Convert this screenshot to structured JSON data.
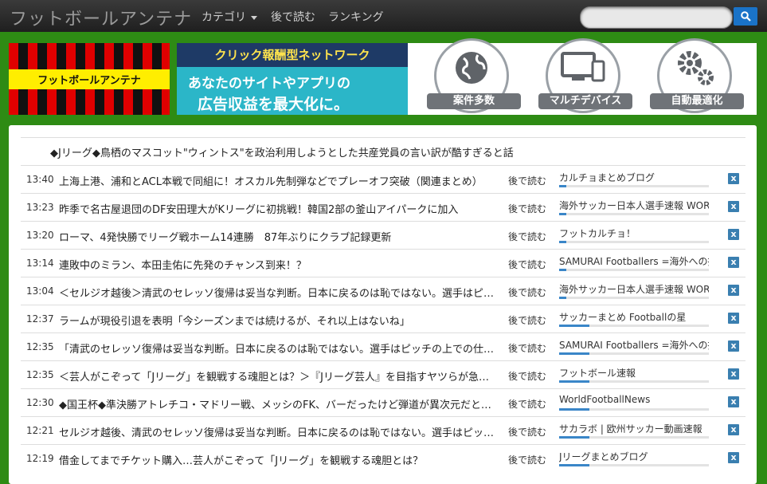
{
  "header": {
    "logo": "フットボールアンテナ",
    "nav": [
      "カテゴリ",
      "後で読む",
      "ランキング"
    ],
    "search_placeholder": ""
  },
  "banner_logo": "フットボールアンテナ",
  "ad": {
    "head": "クリック報酬型ネットワーク",
    "line1": "あなたのサイトやアプリの",
    "line2": "広告収益を最大化に。",
    "features": [
      "案件多数",
      "マルチデバイス",
      "自動最適化"
    ]
  },
  "headline": "◆Jリーグ◆鳥栖のマスコット\"ウィントス\"を政治利用しようとした共産党員の言い訳が酷すぎると話",
  "later_label": "後で読む",
  "close_label": "x",
  "articles": [
    {
      "time": "13:40",
      "title": "上海上港、浦和とACL本戦で同組に！オスカル先制弾などでプレーオフ突破（関連まとめ）",
      "source": "カルチョまとめブログ",
      "popularity": 0.05
    },
    {
      "time": "13:23",
      "title": "昨季で名古屋退団のDF安田理大がKリーグに初挑戦！韓国2部の釜山アイパークに加入",
      "source": "海外サッカー日本人選手速報 WORLD",
      "popularity": 0.05
    },
    {
      "time": "13:20",
      "title": "ローマ、4発快勝でリーグ戦ホーム14連勝　87年ぶりにクラブ記録更新",
      "source": "フットカルチョ！",
      "popularity": 0.05
    },
    {
      "time": "13:14",
      "title": "連敗中のミラン、本田圭佑に先発のチャンス到来！？",
      "source": "SAMURAI Footballers =海外への挑戦=",
      "popularity": 0.05
    },
    {
      "time": "13:04",
      "title": "＜セルジオ越後＞清武のセレッソ復帰は妥当な判断。日本に戻るのは恥ではない。選手はピッチの上での仕事が大事",
      "source": "海外サッカー日本人選手速報 WORLD",
      "popularity": 0.05
    },
    {
      "time": "12:37",
      "title": "ラームが現役引退を表明「今シーズンまでは続けるが、それ以上はないね」",
      "source": "サッカーまとめ Footballの星",
      "popularity": 0.2
    },
    {
      "time": "12:35",
      "title": "「清武のセレッソ復帰は妥当な判断。日本に戻るのは恥ではない。選手はピッチの上での仕事が大事」",
      "source": "SAMURAI Footballers =海外への挑戦=",
      "popularity": 0.2
    },
    {
      "time": "12:35",
      "title": "＜芸人がこぞって「Jリーグ」を観戦する魂胆とは？＞『Jリーグ芸人』を目指すヤツらが急増中",
      "source": "フットボール速報",
      "popularity": 0.2
    },
    {
      "time": "12:30",
      "title": "◆国王杯◆準決勝アトレチコ・マドリー戦、メッシのFK、バーだったけど弾道が異次元だとの声",
      "source": "WorldFootballNews",
      "popularity": 0.2
    },
    {
      "time": "12:21",
      "title": "セルジオ越後、清武のセレッソ復帰は妥当な判断。日本に戻るのは恥ではない。選手はピッチの上での仕事が大事",
      "source": "サカラボ | 欧州サッカー動画速報",
      "popularity": 0.2
    },
    {
      "time": "12:19",
      "title": "借金してまでチケット購入…芸人がこぞって「Jリーグ」を観戦する魂胆とは？",
      "source": "Jリーグまとめブログ",
      "popularity": 0.2
    }
  ]
}
